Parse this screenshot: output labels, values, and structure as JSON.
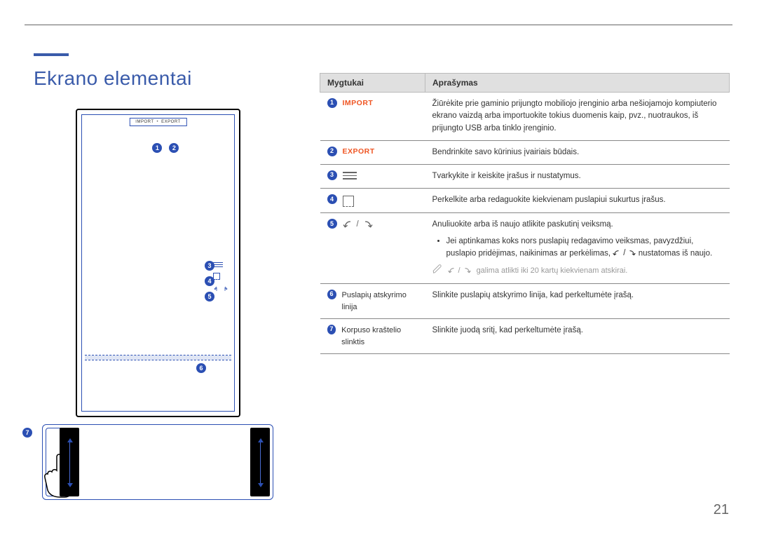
{
  "title": "Ekrano elementai",
  "page_number": "21",
  "device": {
    "topbar_import": "IMPORT",
    "topbar_export": "EXPORT"
  },
  "callouts": {
    "n1": "1",
    "n2": "2",
    "n3": "3",
    "n4": "4",
    "n5": "5",
    "n6": "6",
    "n7": "7"
  },
  "table": {
    "header_buttons": "Mygtukai",
    "header_description": "Aprašymas",
    "rows": [
      {
        "num": "1",
        "label": "IMPORT",
        "desc": "Žiūrėkite prie gaminio prijungto mobiliojo įrenginio arba nešiojamojo kompiuterio ekrano vaizdą arba importuokite tokius duomenis kaip, pvz., nuotraukos, iš prijungto USB arba tinklo įrenginio."
      },
      {
        "num": "2",
        "label": "EXPORT",
        "desc": "Bendrinkite savo kūrinius įvairiais būdais."
      },
      {
        "num": "3",
        "desc": "Tvarkykite ir keiskite įrašus ir nustatymus."
      },
      {
        "num": "4",
        "desc": "Perkelkite arba redaguokite kiekvienam puslapiui sukurtus įrašus."
      },
      {
        "num": "5",
        "desc": "Anuliuokite arba iš naujo atlikite paskutinį veiksmą.",
        "bullet": "Jei aptinkamas koks nors puslapių redagavimo veiksmas, pavyzdžiui, puslapio pridėjimas, naikinimas ar perkėlimas, ",
        "bullet_after": " nustatomas iš naujo.",
        "note": " galima atlikti iki 20 kartų kiekvienam atskirai."
      },
      {
        "num": "6",
        "label": "Puslapių atskyrimo linija",
        "desc": "Slinkite puslapių atskyrimo linija, kad perkeltumėte įrašą."
      },
      {
        "num": "7",
        "label": "Korpuso kraštelio slinktis",
        "desc": "Slinkite juodą sritį, kad perkeltumėte įrašą."
      }
    ]
  }
}
